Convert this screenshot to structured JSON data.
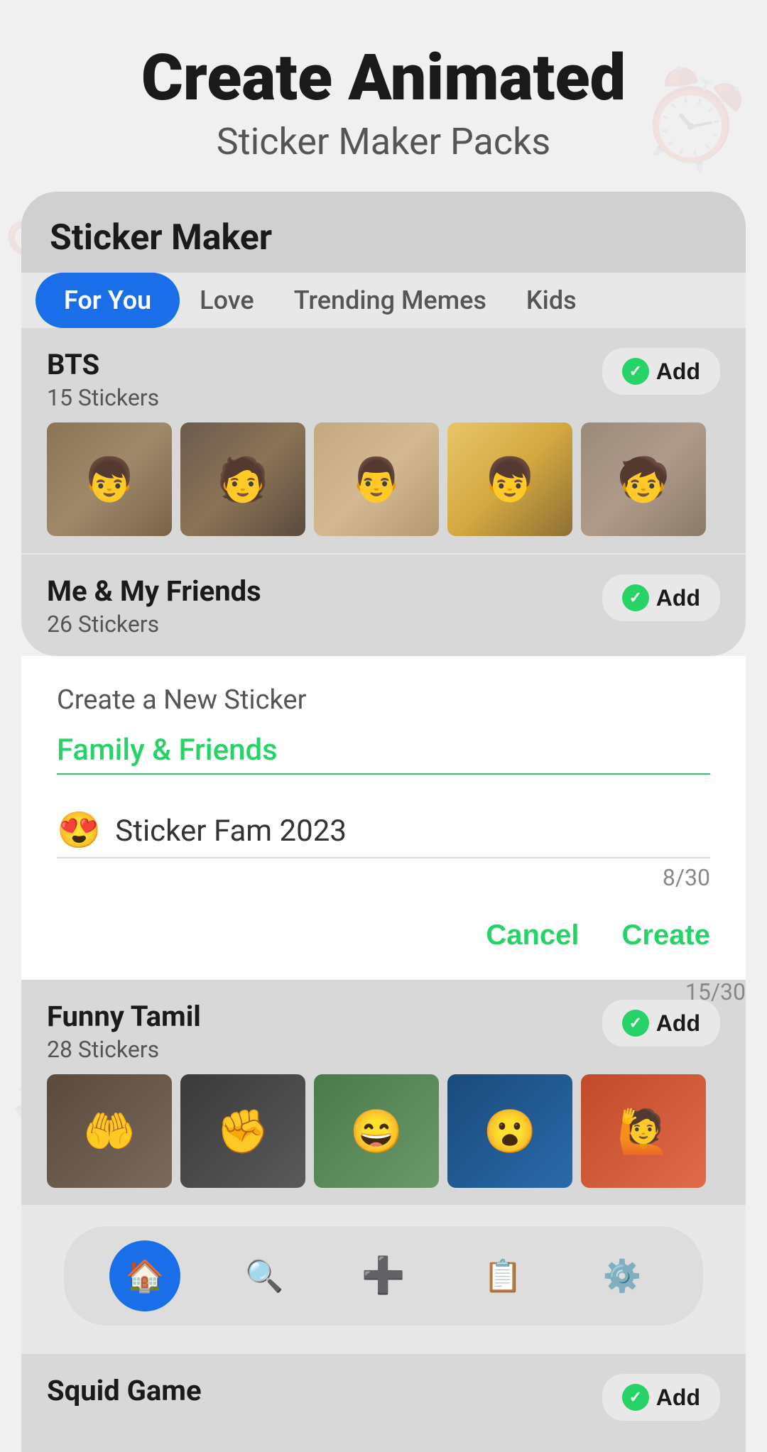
{
  "header": {
    "title_line1": "Create Animated",
    "title_line2": "Sticker Maker Packs"
  },
  "app": {
    "title": "Sticker Maker",
    "tabs": [
      {
        "id": "for-you",
        "label": "For You",
        "active": true
      },
      {
        "id": "love",
        "label": "Love",
        "active": false
      },
      {
        "id": "trending-memes",
        "label": "Trending Memes",
        "active": false
      },
      {
        "id": "kids",
        "label": "Kids",
        "active": false
      }
    ],
    "packs": [
      {
        "id": "bts",
        "name": "BTS",
        "count": "15 Stickers",
        "add_button": "Add"
      },
      {
        "id": "me-and-friends",
        "name": "Me & My Friends",
        "count": "26 Stickers",
        "add_button": "Add"
      },
      {
        "id": "funny-tamil",
        "name": "Funny Tamil",
        "count": "28 Stickers",
        "add_button": "Add"
      },
      {
        "id": "squid-game",
        "name": "Squid Game",
        "count": "",
        "add_button": "Add"
      }
    ]
  },
  "dialog": {
    "title": "Create a New Sticker",
    "input1": {
      "value": "Family & Friends",
      "counter": "15/30"
    },
    "input2": {
      "emoji": "😍",
      "value": "Sticker Fam 2023",
      "counter": "8/30"
    },
    "cancel_label": "Cancel",
    "create_label": "Create"
  },
  "bottom_nav": {
    "items": [
      {
        "id": "home",
        "icon": "🏠",
        "active": true
      },
      {
        "id": "search",
        "icon": "🔍",
        "active": false
      },
      {
        "id": "add",
        "icon": "➕",
        "active": false
      },
      {
        "id": "packs",
        "icon": "📋",
        "active": false
      },
      {
        "id": "settings",
        "icon": "⚙️",
        "active": false
      }
    ]
  }
}
